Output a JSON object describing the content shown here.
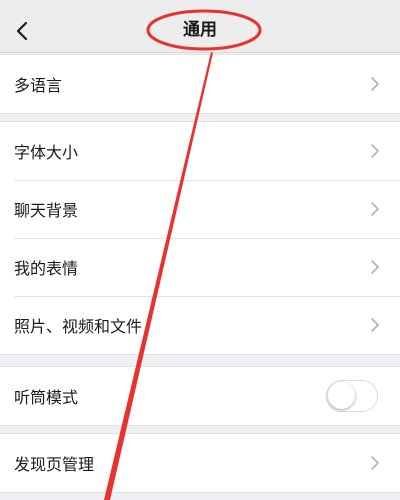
{
  "colors": {
    "page_bg": "#efeff4",
    "bar_bg": "#ededed",
    "annotation_red": "#e8322f",
    "toggle_off": "#dcdcdc"
  },
  "nav": {
    "back_icon": "chevron-left-icon",
    "title": "通用"
  },
  "sections": [
    {
      "items": [
        {
          "label": "多语言",
          "type": "link"
        }
      ]
    },
    {
      "items": [
        {
          "label": "字体大小",
          "type": "link"
        },
        {
          "label": "聊天背景",
          "type": "link"
        },
        {
          "label": "我的表情",
          "type": "link"
        },
        {
          "label": "照片、视频和文件",
          "type": "link"
        }
      ]
    },
    {
      "items": [
        {
          "label": "听筒模式",
          "type": "toggle",
          "checked": false
        }
      ]
    },
    {
      "items": [
        {
          "label": "发现页管理",
          "type": "link"
        }
      ]
    }
  ]
}
